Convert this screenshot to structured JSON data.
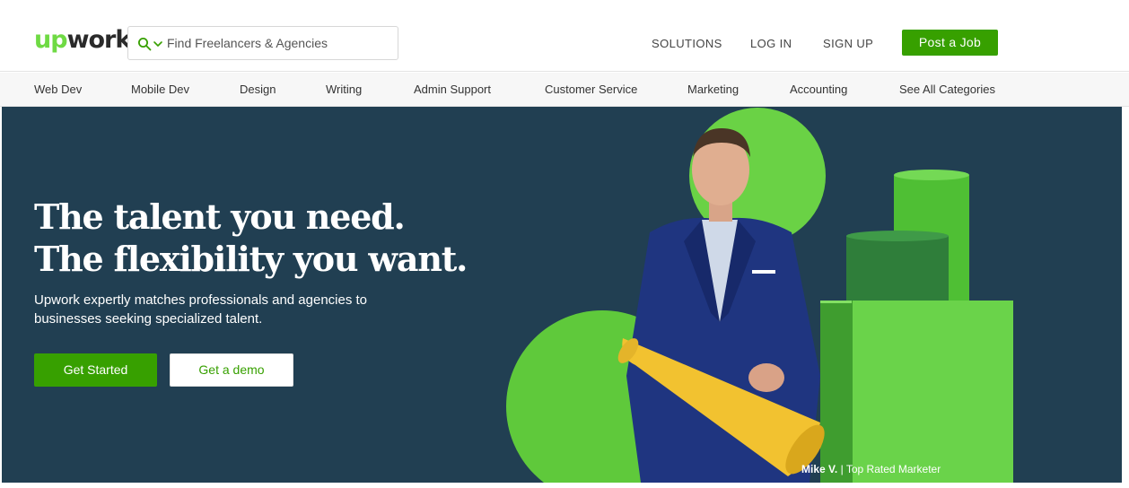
{
  "brand": {
    "logo_up": "up",
    "logo_work": "work",
    "accent": "#6fda44",
    "button_green": "#37a000",
    "hero_bg": "#213f52"
  },
  "search": {
    "placeholder": "Find Freelancers & Agencies",
    "value": ""
  },
  "top_nav": {
    "solutions": "SOLUTIONS",
    "login": "LOG IN",
    "signup": "SIGN UP",
    "post_job": "Post a Job"
  },
  "categories": [
    "Web Dev",
    "Mobile Dev",
    "Design",
    "Writing",
    "Admin Support",
    "Customer Service",
    "Marketing",
    "Accounting",
    "See All Categories"
  ],
  "hero": {
    "headline_line1": "The talent you need.",
    "headline_line2": "The flexibility you want.",
    "subtext": "Upwork expertly matches professionals and agencies to businesses seeking specialized talent.",
    "cta_primary": "Get Started",
    "cta_secondary": "Get a demo",
    "caption_name": "Mike V.",
    "caption_sep": "|",
    "caption_title": "Top Rated Marketer"
  },
  "icons": {
    "search": "search-icon",
    "chevron": "chevron-down-icon"
  }
}
